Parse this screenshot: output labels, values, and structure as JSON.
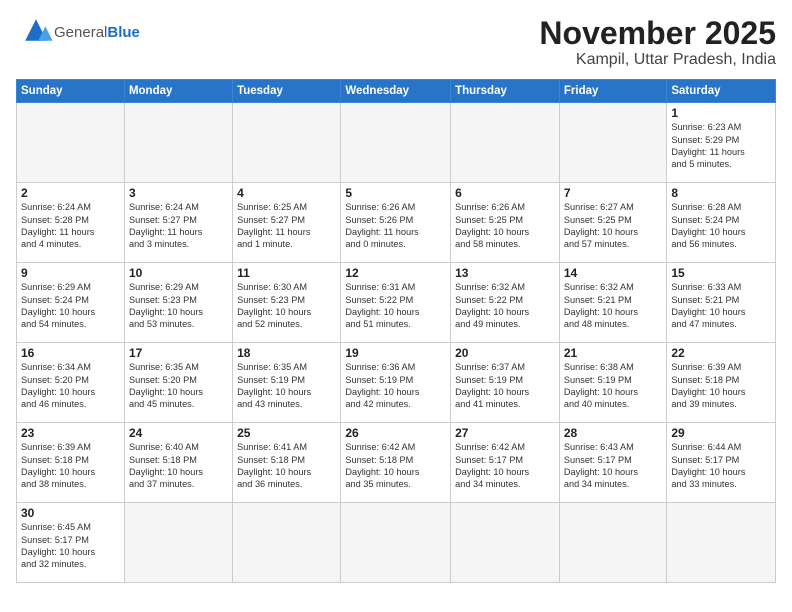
{
  "logo": {
    "text_general": "General",
    "text_blue": "Blue"
  },
  "title": "November 2025",
  "subtitle": "Kampil, Uttar Pradesh, India",
  "weekdays": [
    "Sunday",
    "Monday",
    "Tuesday",
    "Wednesday",
    "Thursday",
    "Friday",
    "Saturday"
  ],
  "weeks": [
    [
      {
        "day": "",
        "info": ""
      },
      {
        "day": "",
        "info": ""
      },
      {
        "day": "",
        "info": ""
      },
      {
        "day": "",
        "info": ""
      },
      {
        "day": "",
        "info": ""
      },
      {
        "day": "",
        "info": ""
      },
      {
        "day": "1",
        "info": "Sunrise: 6:23 AM\nSunset: 5:29 PM\nDaylight: 11 hours\nand 5 minutes."
      }
    ],
    [
      {
        "day": "2",
        "info": "Sunrise: 6:24 AM\nSunset: 5:28 PM\nDaylight: 11 hours\nand 4 minutes."
      },
      {
        "day": "3",
        "info": "Sunrise: 6:24 AM\nSunset: 5:27 PM\nDaylight: 11 hours\nand 3 minutes."
      },
      {
        "day": "4",
        "info": "Sunrise: 6:25 AM\nSunset: 5:27 PM\nDaylight: 11 hours\nand 1 minute."
      },
      {
        "day": "5",
        "info": "Sunrise: 6:26 AM\nSunset: 5:26 PM\nDaylight: 11 hours\nand 0 minutes."
      },
      {
        "day": "6",
        "info": "Sunrise: 6:26 AM\nSunset: 5:25 PM\nDaylight: 10 hours\nand 58 minutes."
      },
      {
        "day": "7",
        "info": "Sunrise: 6:27 AM\nSunset: 5:25 PM\nDaylight: 10 hours\nand 57 minutes."
      },
      {
        "day": "8",
        "info": "Sunrise: 6:28 AM\nSunset: 5:24 PM\nDaylight: 10 hours\nand 56 minutes."
      }
    ],
    [
      {
        "day": "9",
        "info": "Sunrise: 6:29 AM\nSunset: 5:24 PM\nDaylight: 10 hours\nand 54 minutes."
      },
      {
        "day": "10",
        "info": "Sunrise: 6:29 AM\nSunset: 5:23 PM\nDaylight: 10 hours\nand 53 minutes."
      },
      {
        "day": "11",
        "info": "Sunrise: 6:30 AM\nSunset: 5:23 PM\nDaylight: 10 hours\nand 52 minutes."
      },
      {
        "day": "12",
        "info": "Sunrise: 6:31 AM\nSunset: 5:22 PM\nDaylight: 10 hours\nand 51 minutes."
      },
      {
        "day": "13",
        "info": "Sunrise: 6:32 AM\nSunset: 5:22 PM\nDaylight: 10 hours\nand 49 minutes."
      },
      {
        "day": "14",
        "info": "Sunrise: 6:32 AM\nSunset: 5:21 PM\nDaylight: 10 hours\nand 48 minutes."
      },
      {
        "day": "15",
        "info": "Sunrise: 6:33 AM\nSunset: 5:21 PM\nDaylight: 10 hours\nand 47 minutes."
      }
    ],
    [
      {
        "day": "16",
        "info": "Sunrise: 6:34 AM\nSunset: 5:20 PM\nDaylight: 10 hours\nand 46 minutes."
      },
      {
        "day": "17",
        "info": "Sunrise: 6:35 AM\nSunset: 5:20 PM\nDaylight: 10 hours\nand 45 minutes."
      },
      {
        "day": "18",
        "info": "Sunrise: 6:35 AM\nSunset: 5:19 PM\nDaylight: 10 hours\nand 43 minutes."
      },
      {
        "day": "19",
        "info": "Sunrise: 6:36 AM\nSunset: 5:19 PM\nDaylight: 10 hours\nand 42 minutes."
      },
      {
        "day": "20",
        "info": "Sunrise: 6:37 AM\nSunset: 5:19 PM\nDaylight: 10 hours\nand 41 minutes."
      },
      {
        "day": "21",
        "info": "Sunrise: 6:38 AM\nSunset: 5:19 PM\nDaylight: 10 hours\nand 40 minutes."
      },
      {
        "day": "22",
        "info": "Sunrise: 6:39 AM\nSunset: 5:18 PM\nDaylight: 10 hours\nand 39 minutes."
      }
    ],
    [
      {
        "day": "23",
        "info": "Sunrise: 6:39 AM\nSunset: 5:18 PM\nDaylight: 10 hours\nand 38 minutes."
      },
      {
        "day": "24",
        "info": "Sunrise: 6:40 AM\nSunset: 5:18 PM\nDaylight: 10 hours\nand 37 minutes."
      },
      {
        "day": "25",
        "info": "Sunrise: 6:41 AM\nSunset: 5:18 PM\nDaylight: 10 hours\nand 36 minutes."
      },
      {
        "day": "26",
        "info": "Sunrise: 6:42 AM\nSunset: 5:18 PM\nDaylight: 10 hours\nand 35 minutes."
      },
      {
        "day": "27",
        "info": "Sunrise: 6:42 AM\nSunset: 5:17 PM\nDaylight: 10 hours\nand 34 minutes."
      },
      {
        "day": "28",
        "info": "Sunrise: 6:43 AM\nSunset: 5:17 PM\nDaylight: 10 hours\nand 34 minutes."
      },
      {
        "day": "29",
        "info": "Sunrise: 6:44 AM\nSunset: 5:17 PM\nDaylight: 10 hours\nand 33 minutes."
      }
    ],
    [
      {
        "day": "30",
        "info": "Sunrise: 6:45 AM\nSunset: 5:17 PM\nDaylight: 10 hours\nand 32 minutes."
      },
      {
        "day": "",
        "info": ""
      },
      {
        "day": "",
        "info": ""
      },
      {
        "day": "",
        "info": ""
      },
      {
        "day": "",
        "info": ""
      },
      {
        "day": "",
        "info": ""
      },
      {
        "day": "",
        "info": ""
      }
    ]
  ]
}
